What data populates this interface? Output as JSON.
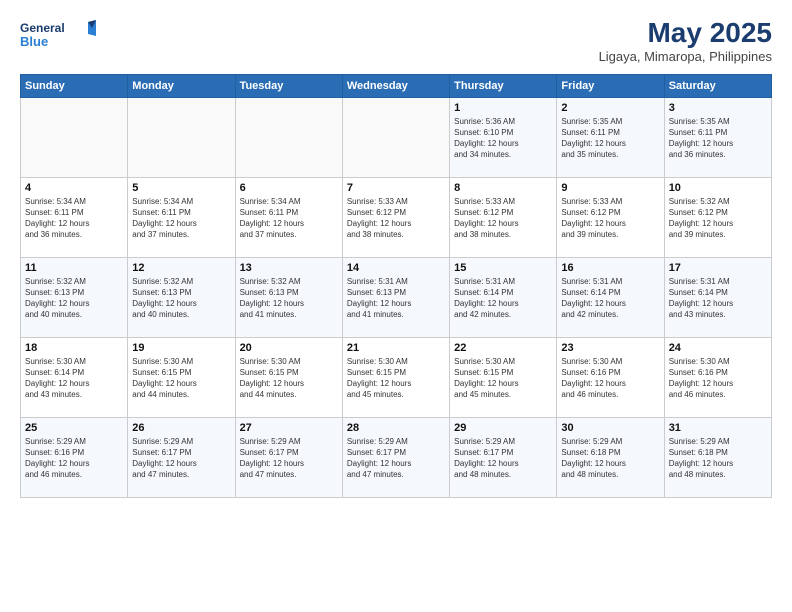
{
  "header": {
    "logo_line1": "General",
    "logo_line2": "Blue",
    "month": "May 2025",
    "location": "Ligaya, Mimaropa, Philippines"
  },
  "weekdays": [
    "Sunday",
    "Monday",
    "Tuesday",
    "Wednesday",
    "Thursday",
    "Friday",
    "Saturday"
  ],
  "weeks": [
    [
      {
        "day": "",
        "info": ""
      },
      {
        "day": "",
        "info": ""
      },
      {
        "day": "",
        "info": ""
      },
      {
        "day": "",
        "info": ""
      },
      {
        "day": "1",
        "info": "Sunrise: 5:36 AM\nSunset: 6:10 PM\nDaylight: 12 hours\nand 34 minutes."
      },
      {
        "day": "2",
        "info": "Sunrise: 5:35 AM\nSunset: 6:11 PM\nDaylight: 12 hours\nand 35 minutes."
      },
      {
        "day": "3",
        "info": "Sunrise: 5:35 AM\nSunset: 6:11 PM\nDaylight: 12 hours\nand 36 minutes."
      }
    ],
    [
      {
        "day": "4",
        "info": "Sunrise: 5:34 AM\nSunset: 6:11 PM\nDaylight: 12 hours\nand 36 minutes."
      },
      {
        "day": "5",
        "info": "Sunrise: 5:34 AM\nSunset: 6:11 PM\nDaylight: 12 hours\nand 37 minutes."
      },
      {
        "day": "6",
        "info": "Sunrise: 5:34 AM\nSunset: 6:11 PM\nDaylight: 12 hours\nand 37 minutes."
      },
      {
        "day": "7",
        "info": "Sunrise: 5:33 AM\nSunset: 6:12 PM\nDaylight: 12 hours\nand 38 minutes."
      },
      {
        "day": "8",
        "info": "Sunrise: 5:33 AM\nSunset: 6:12 PM\nDaylight: 12 hours\nand 38 minutes."
      },
      {
        "day": "9",
        "info": "Sunrise: 5:33 AM\nSunset: 6:12 PM\nDaylight: 12 hours\nand 39 minutes."
      },
      {
        "day": "10",
        "info": "Sunrise: 5:32 AM\nSunset: 6:12 PM\nDaylight: 12 hours\nand 39 minutes."
      }
    ],
    [
      {
        "day": "11",
        "info": "Sunrise: 5:32 AM\nSunset: 6:13 PM\nDaylight: 12 hours\nand 40 minutes."
      },
      {
        "day": "12",
        "info": "Sunrise: 5:32 AM\nSunset: 6:13 PM\nDaylight: 12 hours\nand 40 minutes."
      },
      {
        "day": "13",
        "info": "Sunrise: 5:32 AM\nSunset: 6:13 PM\nDaylight: 12 hours\nand 41 minutes."
      },
      {
        "day": "14",
        "info": "Sunrise: 5:31 AM\nSunset: 6:13 PM\nDaylight: 12 hours\nand 41 minutes."
      },
      {
        "day": "15",
        "info": "Sunrise: 5:31 AM\nSunset: 6:14 PM\nDaylight: 12 hours\nand 42 minutes."
      },
      {
        "day": "16",
        "info": "Sunrise: 5:31 AM\nSunset: 6:14 PM\nDaylight: 12 hours\nand 42 minutes."
      },
      {
        "day": "17",
        "info": "Sunrise: 5:31 AM\nSunset: 6:14 PM\nDaylight: 12 hours\nand 43 minutes."
      }
    ],
    [
      {
        "day": "18",
        "info": "Sunrise: 5:30 AM\nSunset: 6:14 PM\nDaylight: 12 hours\nand 43 minutes."
      },
      {
        "day": "19",
        "info": "Sunrise: 5:30 AM\nSunset: 6:15 PM\nDaylight: 12 hours\nand 44 minutes."
      },
      {
        "day": "20",
        "info": "Sunrise: 5:30 AM\nSunset: 6:15 PM\nDaylight: 12 hours\nand 44 minutes."
      },
      {
        "day": "21",
        "info": "Sunrise: 5:30 AM\nSunset: 6:15 PM\nDaylight: 12 hours\nand 45 minutes."
      },
      {
        "day": "22",
        "info": "Sunrise: 5:30 AM\nSunset: 6:15 PM\nDaylight: 12 hours\nand 45 minutes."
      },
      {
        "day": "23",
        "info": "Sunrise: 5:30 AM\nSunset: 6:16 PM\nDaylight: 12 hours\nand 46 minutes."
      },
      {
        "day": "24",
        "info": "Sunrise: 5:30 AM\nSunset: 6:16 PM\nDaylight: 12 hours\nand 46 minutes."
      }
    ],
    [
      {
        "day": "25",
        "info": "Sunrise: 5:29 AM\nSunset: 6:16 PM\nDaylight: 12 hours\nand 46 minutes."
      },
      {
        "day": "26",
        "info": "Sunrise: 5:29 AM\nSunset: 6:17 PM\nDaylight: 12 hours\nand 47 minutes."
      },
      {
        "day": "27",
        "info": "Sunrise: 5:29 AM\nSunset: 6:17 PM\nDaylight: 12 hours\nand 47 minutes."
      },
      {
        "day": "28",
        "info": "Sunrise: 5:29 AM\nSunset: 6:17 PM\nDaylight: 12 hours\nand 47 minutes."
      },
      {
        "day": "29",
        "info": "Sunrise: 5:29 AM\nSunset: 6:17 PM\nDaylight: 12 hours\nand 48 minutes."
      },
      {
        "day": "30",
        "info": "Sunrise: 5:29 AM\nSunset: 6:18 PM\nDaylight: 12 hours\nand 48 minutes."
      },
      {
        "day": "31",
        "info": "Sunrise: 5:29 AM\nSunset: 6:18 PM\nDaylight: 12 hours\nand 48 minutes."
      }
    ]
  ]
}
